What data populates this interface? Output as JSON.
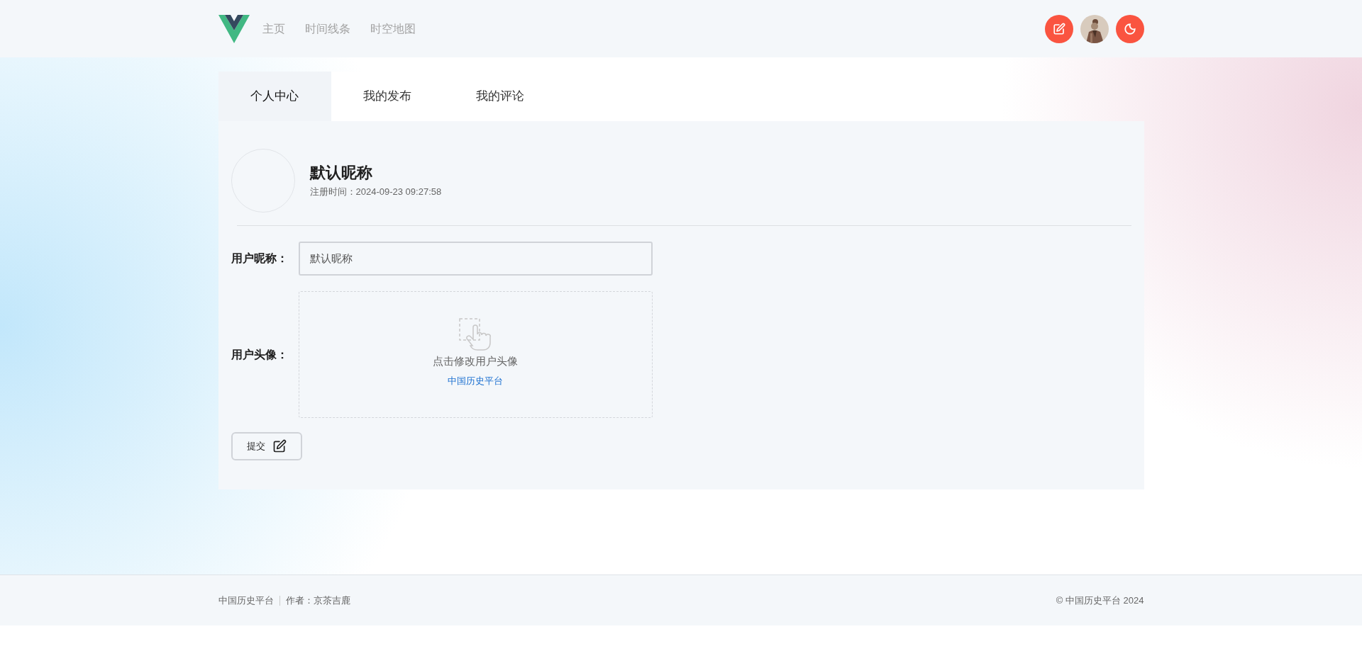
{
  "header": {
    "nav": [
      {
        "label": "主页",
        "selected": false
      },
      {
        "label": "时间线条",
        "selected": false
      },
      {
        "label": "时空地图",
        "selected": false
      }
    ]
  },
  "tabs": [
    {
      "label": "个人中心",
      "selected": true
    },
    {
      "label": "我的发布",
      "selected": false
    },
    {
      "label": "我的评论",
      "selected": false
    }
  ],
  "profile": {
    "nickname": "默认昵称",
    "registered": "注册时间：2024-09-23 09:27:58"
  },
  "form": {
    "nickname_label": "用户昵称：",
    "nickname_value": "默认昵称",
    "avatar_label": "用户头像：",
    "upload_hint": "点击修改用户头像",
    "upload_link": "中国历史平台",
    "submit": "提交"
  },
  "footer": {
    "site": "中国历史平台",
    "author": "作者：京茶吉鹿",
    "copyright": "© 中国历史平台 2024"
  }
}
